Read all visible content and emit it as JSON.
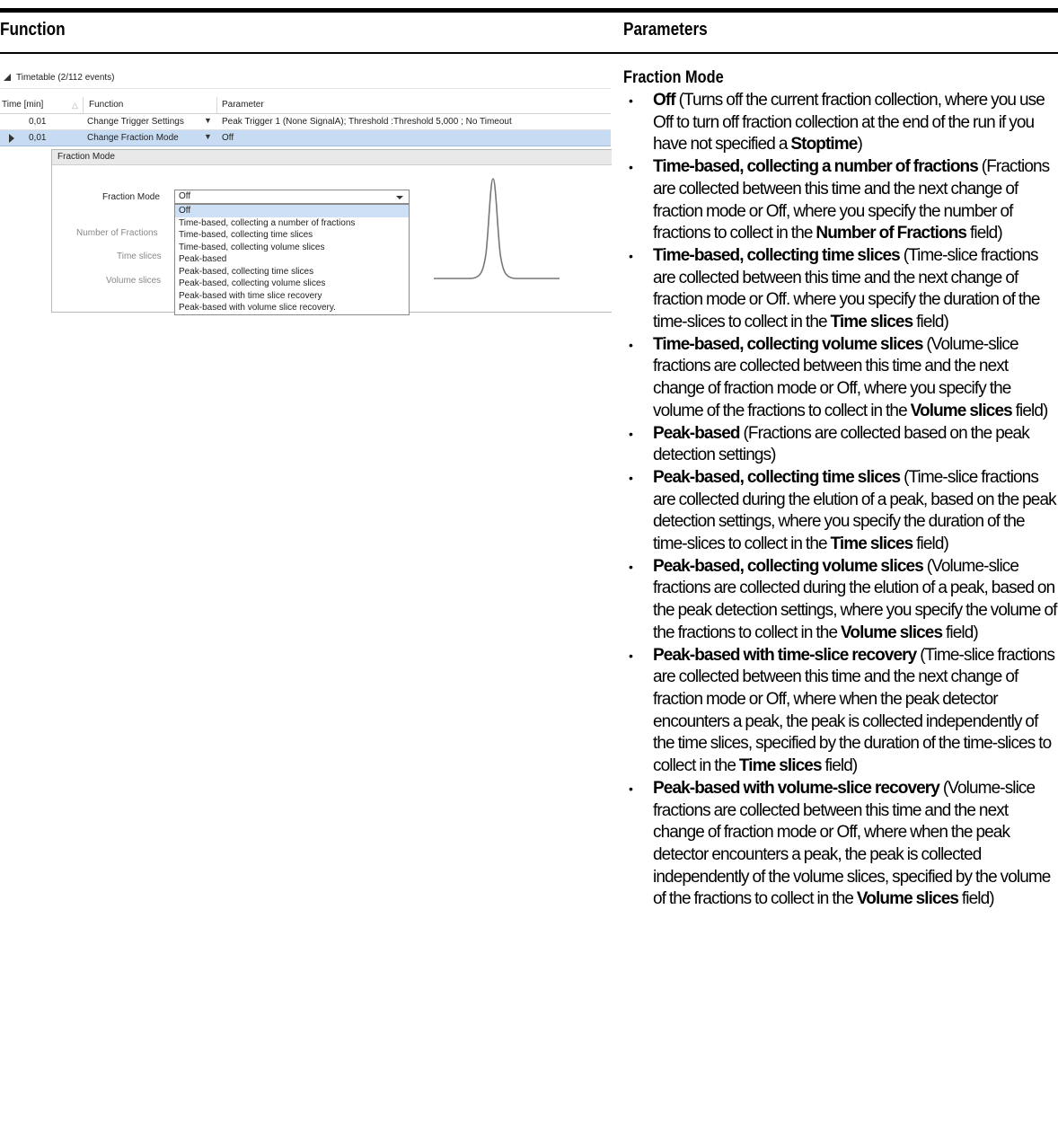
{
  "header": {
    "function_label": "Function",
    "parameters_label": "Parameters"
  },
  "ui": {
    "timetable_title": "Timetable (2/112 events)",
    "columns": {
      "time": "Time [min]",
      "function": "Function",
      "parameter": "Parameter"
    },
    "rows": [
      {
        "time": "0,01",
        "function": "Change Trigger Settings",
        "parameter": "Peak Trigger 1 (None SignalA); Threshold :Threshold 5,000 ; No Timeout"
      },
      {
        "time": "0,01",
        "function": "Change Fraction Mode",
        "parameter": "Off"
      }
    ],
    "detail": {
      "title": "Fraction Mode",
      "fraction_mode_label": "Fraction Mode",
      "fraction_mode_value": "Off",
      "number_of_fractions_label": "Number of Fractions",
      "time_slices_label": "Time slices",
      "volume_slices_label": "Volume slices",
      "options": [
        "Off",
        "Time-based, collecting a number of fractions",
        "Time-based, collecting time slices",
        "Time-based, collecting volume slices",
        "Peak-based",
        "Peak-based, collecting time slices",
        "Peak-based, collecting volume slices",
        "Peak-based with time slice recovery",
        "Peak-based with volume slice recovery."
      ]
    }
  },
  "parameters": {
    "title": "Fraction Mode",
    "bullet": "•",
    "items": [
      {
        "pre": "",
        "bold": "Off",
        "text": " (Turns off the current fraction collection, where you use Off to turn off fraction collection at the end of the run if you have not specified a ",
        "bold2": "Stoptime",
        "text2": ")"
      },
      {
        "pre": "",
        "bold": "Time-based, collecting a number of fractions",
        "text": " (Fractions are collected between this time and the next change of fraction mode or Off, where you specify the number of fractions to collect in the ",
        "bold2": "Number of Fractions",
        "text2": " field)"
      },
      {
        "pre": "",
        "bold": "Time-based, collecting time slices",
        "text": " (Time-slice fractions are collected between this time and the next change of fraction mode or Off. where you specify the duration of the time-slices to collect in the ",
        "bold2": "Time slices",
        "text2": " field)"
      },
      {
        "pre": "",
        "bold": "Time-based, collecting volume slices",
        "text": " (Volume-slice fractions are collected between this time and the next change of fraction mode or Off, where you specify the volume of the fractions to collect in the ",
        "bold2": "Volume slices",
        "text2": " field)"
      },
      {
        "pre": "",
        "bold": "Peak-based",
        "text": " (Fractions are collected based on the peak detection settings)",
        "bold2": "",
        "text2": ""
      },
      {
        "pre": "",
        "bold": "Peak-based, collecting time slices",
        "text": " (Time-slice fractions are collected during the elution of a peak, based on the peak detection settings, where you specify the duration of the time-slices to collect in the ",
        "bold2": "Time slices",
        "text2": " field)"
      },
      {
        "pre": "",
        "bold": "Peak-based, collecting volume slices",
        "text": " (Volume-slice fractions are collected during the elution of a peak, based on the peak detection settings, where you specify the volume of the fractions to collect in the ",
        "bold2": "Volume slices",
        "text2": " field)"
      },
      {
        "pre": "",
        "bold": "Peak-based with time-slice recovery",
        "text": " (Time-slice fractions are collected between this time and the next change of fraction mode or Off, where when the peak detector encounters a peak, the peak is collected independently of the time slices, specified by the duration of the time-slices to collect in the ",
        "bold2": "Time slices",
        "text2": " field)"
      },
      {
        "pre": "",
        "bold": "Peak-based with volume-slice recovery",
        "text": " (Volume-slice fractions are collected between this time and the next change of fraction mode or Off, where when the peak detector encounters a peak, the peak is collected independently of the volume slices, specified by the volume of the fractions to collect in the ",
        "bold2": "Volume slices",
        "text2": " field)"
      }
    ]
  }
}
